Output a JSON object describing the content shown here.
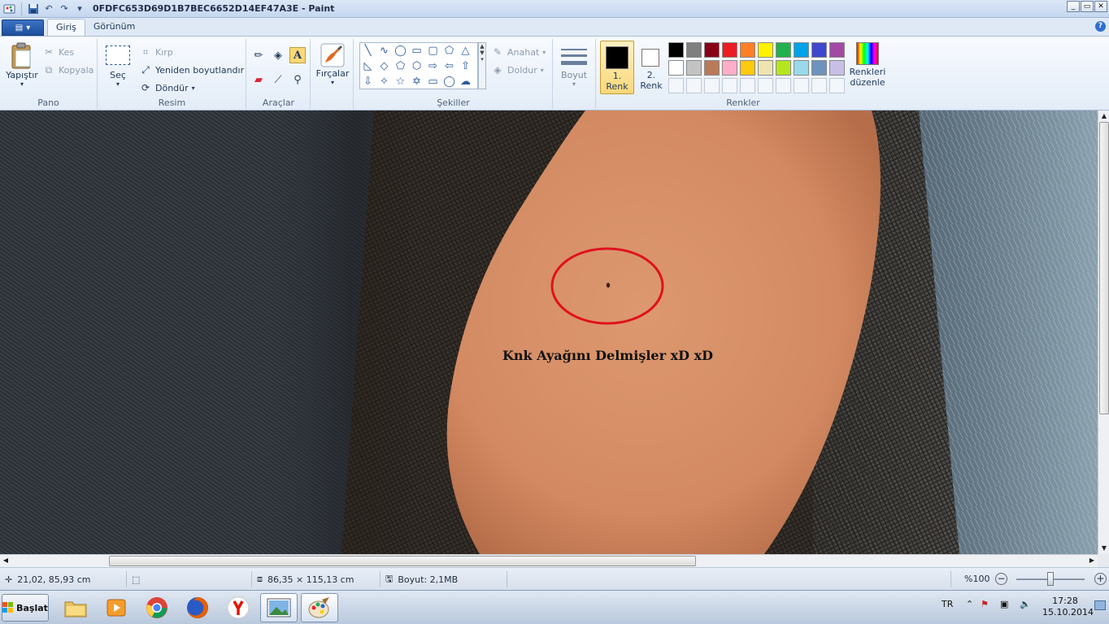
{
  "window": {
    "title": "0FDFC653D69D1B7BEC6652D14EF47A3E - Paint",
    "controls": [
      "_",
      "▭",
      "✕"
    ]
  },
  "tabs": [
    {
      "label": "Giriş",
      "active": true
    },
    {
      "label": "Görünüm",
      "active": false
    }
  ],
  "ribbon": {
    "pano": {
      "label": "Pano",
      "paste": "Yapıştır",
      "cut": "Kes",
      "copy": "Kopyala"
    },
    "resim": {
      "label": "Resim",
      "select": "Seç",
      "crop": "Kırp",
      "resize": "Yeniden boyutlandır",
      "rotate": "Döndür"
    },
    "araclar": {
      "label": "Araçlar"
    },
    "brushes": {
      "label": "Fırçalar"
    },
    "sekiller": {
      "label": "Şekiller",
      "outline": "Anahat",
      "fill": "Doldur"
    },
    "size": {
      "label": "Boyut"
    },
    "colors": {
      "label": "Renkler",
      "color1": "1. Renk",
      "color2": "2. Renk",
      "edit": "Renkleri düzenle",
      "color1_value": "#000000",
      "color2_value": "#ffffff",
      "palette_row1": [
        "#000000",
        "#7f7f7f",
        "#880015",
        "#ed1c24",
        "#ff7f27",
        "#fff200",
        "#22b14c",
        "#00a2e8",
        "#3f48cc",
        "#a349a4"
      ],
      "palette_row2": [
        "#ffffff",
        "#c3c3c3",
        "#b97a57",
        "#ffaec9",
        "#ffc90e",
        "#efe4b0",
        "#b5e61d",
        "#99d9ea",
        "#7092be",
        "#c8bfe7"
      ]
    }
  },
  "canvas": {
    "caption": "Knk Ayağını Delmişler xD xD",
    "annotation_color": "#e0121c"
  },
  "status": {
    "cursor_pos": "21,02, 85,93 cm",
    "image_size": "86,35 × 115,13 cm",
    "file_size": "Boyut: 2,1MB",
    "zoom": "%100",
    "zoom_level": 0.5
  },
  "taskbar": {
    "start": "Başlat",
    "lang": "TR",
    "time": "17:28",
    "date": "15.10.2014"
  }
}
